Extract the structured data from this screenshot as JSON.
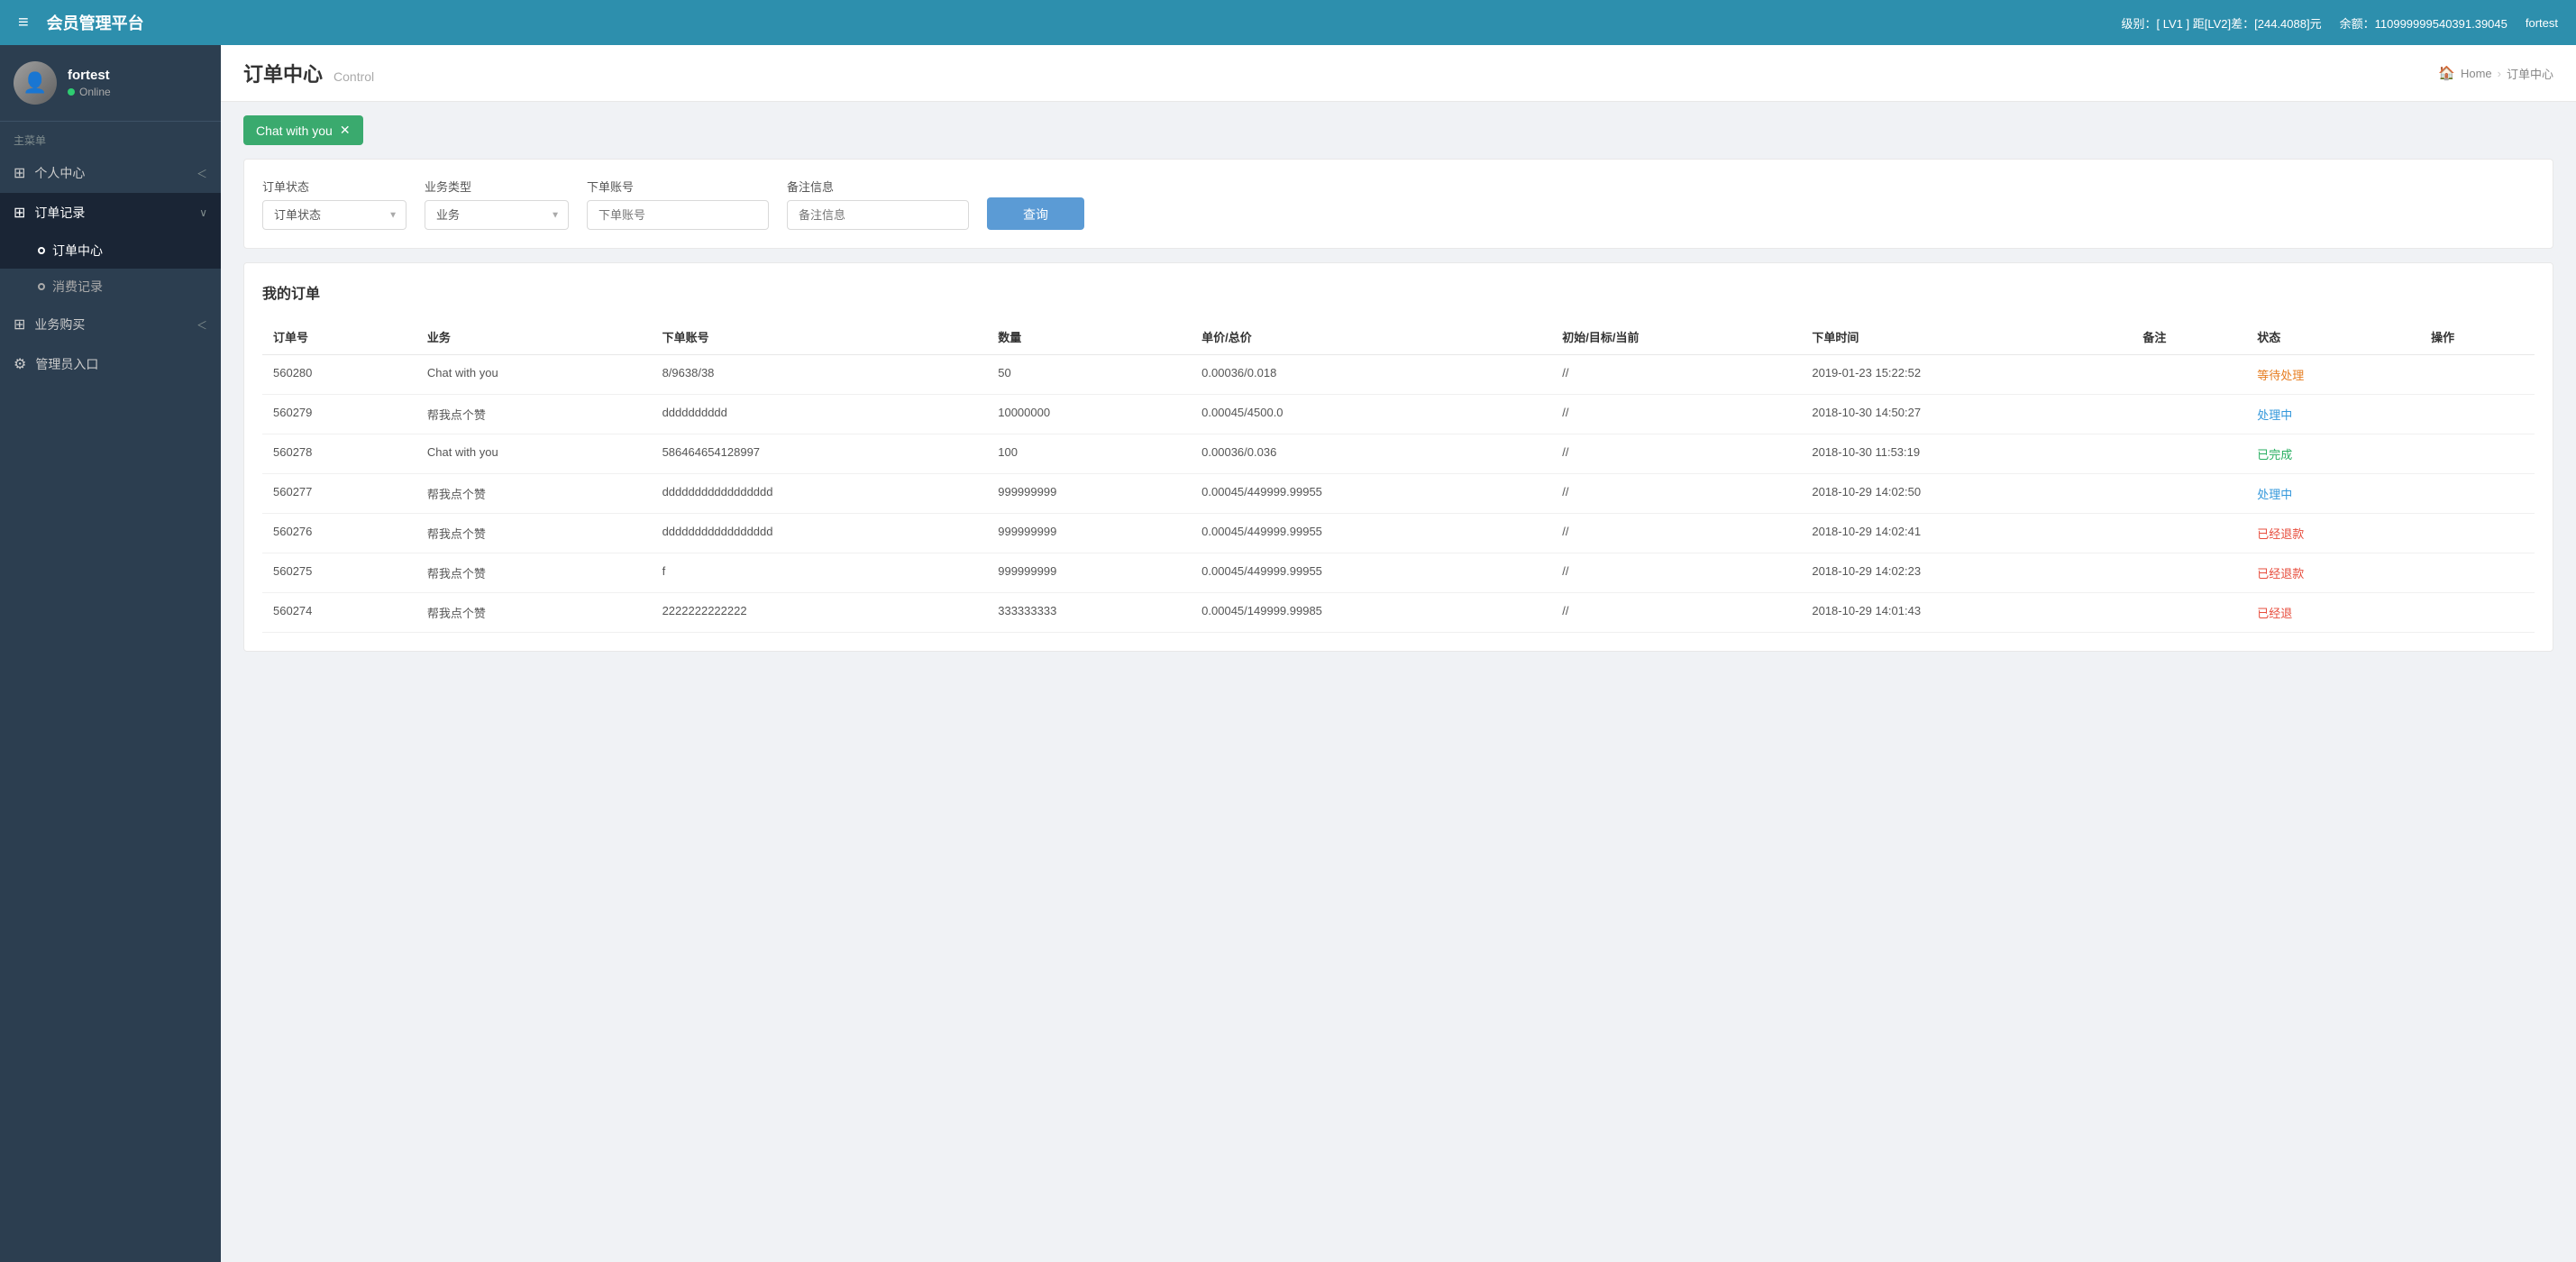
{
  "header": {
    "site_title": "会员管理平台",
    "menu_icon": "≡",
    "level_info": "级别：[ LV1 ] 距[LV2]差：[244.4088]元",
    "level_label": "级别：[ ",
    "level_value": "LV1",
    "level_mid": " ] 距[LV2]差：[",
    "level_diff": "244.4088",
    "level_end": "]元",
    "balance_label": "余额：",
    "balance_value": "110999999540391.39045",
    "username": "fortest"
  },
  "sidebar": {
    "username": "fortest",
    "status": "Online",
    "menu_label": "主菜单",
    "items": [
      {
        "id": "personal",
        "label": "个人中心",
        "icon": "⊞",
        "has_children": true,
        "expanded": false
      },
      {
        "id": "orders",
        "label": "订单记录",
        "icon": "⊞",
        "has_children": true,
        "expanded": true
      },
      {
        "id": "order-center",
        "label": "订单中心",
        "is_sub": true,
        "active": true
      },
      {
        "id": "consumption",
        "label": "消费记录",
        "is_sub": true,
        "active": false
      },
      {
        "id": "business",
        "label": "业务购买",
        "icon": "⊞",
        "has_children": true,
        "expanded": false
      },
      {
        "id": "admin",
        "label": "管理员入口",
        "icon": "⚙",
        "has_children": false
      }
    ]
  },
  "page": {
    "title": "订单中心",
    "subtitle": "Control",
    "breadcrumb_home": "Home",
    "breadcrumb_current": "订单中心"
  },
  "filter_tag": {
    "label": "Chat with you",
    "close": "✕"
  },
  "filter": {
    "status_label": "订单状态",
    "status_placeholder": "订单状态",
    "business_label": "业务类型",
    "business_placeholder": "业务",
    "account_label": "下单账号",
    "account_placeholder": "下单账号",
    "remark_label": "备注信息",
    "remark_placeholder": "备注信息",
    "query_button": "查询"
  },
  "orders": {
    "section_title": "我的订单",
    "columns": [
      "订单号",
      "业务",
      "下单账号",
      "数量",
      "单价/总价",
      "初始/目标/当前",
      "下单时间",
      "备注",
      "状态",
      "操作"
    ],
    "rows": [
      {
        "order_no": "560280",
        "business": "Chat with you",
        "account": "8/9638/38",
        "quantity": "50",
        "price": "0.00036/0.018",
        "target": "//",
        "time": "2019-01-23 15:22:52",
        "remark": "",
        "status": "等待处理",
        "status_class": "status-pending",
        "operation": ""
      },
      {
        "order_no": "560279",
        "business": "帮我点个赞",
        "account": "dddddddddd",
        "quantity": "10000000",
        "price": "0.00045/4500.0",
        "target": "//",
        "time": "2018-10-30 14:50:27",
        "remark": "",
        "status": "处理中",
        "status_class": "status-processing",
        "operation": ""
      },
      {
        "order_no": "560278",
        "business": "Chat with you",
        "account": "586464654128997",
        "quantity": "100",
        "price": "0.00036/0.036",
        "target": "//",
        "time": "2018-10-30 11:53:19",
        "remark": "",
        "status": "已完成",
        "status_class": "status-done",
        "operation": ""
      },
      {
        "order_no": "560277",
        "business": "帮我点个赞",
        "account": "ddddddddddddddddd",
        "quantity": "999999999",
        "price": "0.00045/449999.99955",
        "target": "//",
        "time": "2018-10-29 14:02:50",
        "remark": "",
        "status": "处理中",
        "status_class": "status-processing",
        "operation": ""
      },
      {
        "order_no": "560276",
        "business": "帮我点个赞",
        "account": "ddddddddddddddddd",
        "quantity": "999999999",
        "price": "0.00045/449999.99955",
        "target": "//",
        "time": "2018-10-29 14:02:41",
        "remark": "",
        "status": "已经退款",
        "status_class": "status-refunded",
        "operation": ""
      },
      {
        "order_no": "560275",
        "business": "帮我点个赞",
        "account": "f",
        "quantity": "999999999",
        "price": "0.00045/449999.99955",
        "target": "//",
        "time": "2018-10-29 14:02:23",
        "remark": "",
        "status": "已经退款",
        "status_class": "status-refunded",
        "operation": ""
      },
      {
        "order_no": "560274",
        "business": "帮我点个赞",
        "account": "2222222222222",
        "quantity": "333333333",
        "price": "0.00045/149999.99985",
        "target": "//",
        "time": "2018-10-29 14:01:43",
        "remark": "",
        "status": "已经退",
        "status_class": "status-refunded",
        "operation": ""
      }
    ]
  }
}
